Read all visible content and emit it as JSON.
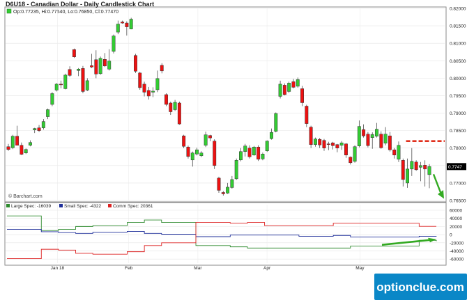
{
  "header": {
    "title": "D6U18 - Canadian Dollar - Daily Candlestick Chart",
    "ohlc": "Op:0.77235, Hi:0.77540, Lo:0.76850, Cl:0.77470",
    "watermark": "© Barchart.com",
    "brand": "optionclue.com"
  },
  "colors": {
    "bull": "#33cc33",
    "bear": "#ee1111",
    "large_spec": "#2e8b2e",
    "small_spec": "#1f2f9a",
    "comm_spec": "#dd2222",
    "target_line": "#e0301e",
    "arrow": "#33aa22",
    "brand_bg": "#0a87c7"
  },
  "chart_data": [
    {
      "type": "candlestick",
      "title": "D6U18 - Canadian Dollar - Daily Candlestick Chart",
      "ylim": [
        0.765,
        0.82
      ],
      "yticks": [
        "0.82000",
        "0.81500",
        "0.81000",
        "0.80500",
        "0.80000",
        "0.79500",
        "0.79000",
        "0.78500",
        "0.78000",
        "0.77500",
        "0.77000",
        "0.76500"
      ],
      "last_price_label": "0.7747",
      "months": [
        "Jan 18",
        "Feb",
        "Mar",
        "Apr",
        "May"
      ],
      "annotation": {
        "type": "dashed-level",
        "value": 0.782
      },
      "candles": [
        {
          "o": 0.7804,
          "h": 0.7812,
          "l": 0.7792,
          "c": 0.7796
        },
        {
          "o": 0.7801,
          "h": 0.7838,
          "l": 0.7797,
          "c": 0.7834
        },
        {
          "o": 0.7834,
          "h": 0.7864,
          "l": 0.7808,
          "c": 0.7808
        },
        {
          "o": 0.7808,
          "h": 0.7816,
          "l": 0.778,
          "c": 0.7782
        },
        {
          "o": 0.7786,
          "h": 0.7799,
          "l": 0.7783,
          "c": 0.7796
        },
        {
          "o": 0.7808,
          "h": 0.7822,
          "l": 0.7805,
          "c": 0.7816
        },
        {
          "o": 0.7852,
          "h": 0.7858,
          "l": 0.7843,
          "c": 0.7856
        },
        {
          "o": 0.7858,
          "h": 0.7866,
          "l": 0.7846,
          "c": 0.785
        },
        {
          "o": 0.7858,
          "h": 0.7883,
          "l": 0.7853,
          "c": 0.7876
        },
        {
          "o": 0.789,
          "h": 0.7913,
          "l": 0.7883,
          "c": 0.791
        },
        {
          "o": 0.7925,
          "h": 0.796,
          "l": 0.792,
          "c": 0.7956
        },
        {
          "o": 0.7966,
          "h": 0.7986,
          "l": 0.7962,
          "c": 0.7983
        },
        {
          "o": 0.7983,
          "h": 0.7993,
          "l": 0.7971,
          "c": 0.7982
        },
        {
          "o": 0.797,
          "h": 0.8013,
          "l": 0.7968,
          "c": 0.8009
        },
        {
          "o": 0.8025,
          "h": 0.8034,
          "l": 0.8004,
          "c": 0.8008
        },
        {
          "o": 0.8082,
          "h": 0.8085,
          "l": 0.8058,
          "c": 0.8061
        },
        {
          "o": 0.8022,
          "h": 0.8029,
          "l": 0.8006,
          "c": 0.8026
        },
        {
          "o": 0.8028,
          "h": 0.8035,
          "l": 0.7957,
          "c": 0.7962
        },
        {
          "o": 0.7966,
          "h": 0.8,
          "l": 0.7963,
          "c": 0.7993
        },
        {
          "o": 0.8036,
          "h": 0.807,
          "l": 0.8029,
          "c": 0.8032
        },
        {
          "o": 0.8053,
          "h": 0.808,
          "l": 0.8,
          "c": 0.8012
        },
        {
          "o": 0.8013,
          "h": 0.8062,
          "l": 0.801,
          "c": 0.8057
        },
        {
          "o": 0.8054,
          "h": 0.8072,
          "l": 0.8032,
          "c": 0.8035
        },
        {
          "o": 0.8026,
          "h": 0.8083,
          "l": 0.8022,
          "c": 0.8049
        },
        {
          "o": 0.8077,
          "h": 0.8125,
          "l": 0.8071,
          "c": 0.8121
        },
        {
          "o": 0.8132,
          "h": 0.8165,
          "l": 0.8126,
          "c": 0.8155
        },
        {
          "o": 0.8161,
          "h": 0.8165,
          "l": 0.8156,
          "c": 0.8158
        },
        {
          "o": 0.8158,
          "h": 0.8163,
          "l": 0.8122,
          "c": 0.8147
        },
        {
          "o": 0.8141,
          "h": 0.8173,
          "l": 0.814,
          "c": 0.8169
        },
        {
          "o": 0.8065,
          "h": 0.807,
          "l": 0.8015,
          "c": 0.802
        },
        {
          "o": 0.8015,
          "h": 0.8018,
          "l": 0.7967,
          "c": 0.7973
        },
        {
          "o": 0.7983,
          "h": 0.799,
          "l": 0.7948,
          "c": 0.796
        },
        {
          "o": 0.7965,
          "h": 0.7975,
          "l": 0.7939,
          "c": 0.7949
        },
        {
          "o": 0.796,
          "h": 0.7974,
          "l": 0.7946,
          "c": 0.7963
        },
        {
          "o": 0.7967,
          "h": 0.8022,
          "l": 0.796,
          "c": 0.7999
        },
        {
          "o": 0.8037,
          "h": 0.8043,
          "l": 0.8014,
          "c": 0.8021
        },
        {
          "o": 0.7953,
          "h": 0.7957,
          "l": 0.792,
          "c": 0.7925
        },
        {
          "o": 0.7929,
          "h": 0.7933,
          "l": 0.7895,
          "c": 0.7904
        },
        {
          "o": 0.791,
          "h": 0.7938,
          "l": 0.7906,
          "c": 0.7931
        },
        {
          "o": 0.7929,
          "h": 0.7933,
          "l": 0.7867,
          "c": 0.7869
        },
        {
          "o": 0.7835,
          "h": 0.7838,
          "l": 0.78,
          "c": 0.7805
        },
        {
          "o": 0.7803,
          "h": 0.7807,
          "l": 0.777,
          "c": 0.7776
        },
        {
          "o": 0.7766,
          "h": 0.779,
          "l": 0.7747,
          "c": 0.7786
        },
        {
          "o": 0.7783,
          "h": 0.7801,
          "l": 0.7779,
          "c": 0.7795
        },
        {
          "o": 0.7778,
          "h": 0.7791,
          "l": 0.7774,
          "c": 0.7786
        },
        {
          "o": 0.7808,
          "h": 0.7847,
          "l": 0.7803,
          "c": 0.7838
        },
        {
          "o": 0.7836,
          "h": 0.7838,
          "l": 0.782,
          "c": 0.7829
        },
        {
          "o": 0.782,
          "h": 0.7825,
          "l": 0.774,
          "c": 0.775
        },
        {
          "o": 0.7714,
          "h": 0.7718,
          "l": 0.7672,
          "c": 0.7679
        },
        {
          "o": 0.7673,
          "h": 0.7677,
          "l": 0.7664,
          "c": 0.7669
        },
        {
          "o": 0.7671,
          "h": 0.77,
          "l": 0.7669,
          "c": 0.7688
        },
        {
          "o": 0.7687,
          "h": 0.772,
          "l": 0.7684,
          "c": 0.771
        },
        {
          "o": 0.7712,
          "h": 0.777,
          "l": 0.7709,
          "c": 0.7765
        },
        {
          "o": 0.7766,
          "h": 0.78,
          "l": 0.7762,
          "c": 0.779
        },
        {
          "o": 0.779,
          "h": 0.7812,
          "l": 0.7776,
          "c": 0.7806
        },
        {
          "o": 0.78,
          "h": 0.7808,
          "l": 0.777,
          "c": 0.7775
        },
        {
          "o": 0.778,
          "h": 0.7806,
          "l": 0.7778,
          "c": 0.7803
        },
        {
          "o": 0.7803,
          "h": 0.7808,
          "l": 0.7763,
          "c": 0.7768
        },
        {
          "o": 0.7769,
          "h": 0.7787,
          "l": 0.7765,
          "c": 0.7783
        },
        {
          "o": 0.7792,
          "h": 0.7822,
          "l": 0.7789,
          "c": 0.782
        },
        {
          "o": 0.7827,
          "h": 0.7856,
          "l": 0.7824,
          "c": 0.7845
        },
        {
          "o": 0.7848,
          "h": 0.7902,
          "l": 0.7845,
          "c": 0.7899
        },
        {
          "o": 0.7948,
          "h": 0.7993,
          "l": 0.7942,
          "c": 0.7983
        },
        {
          "o": 0.798,
          "h": 0.7985,
          "l": 0.7951,
          "c": 0.7953
        },
        {
          "o": 0.7962,
          "h": 0.799,
          "l": 0.7958,
          "c": 0.7986
        },
        {
          "o": 0.799,
          "h": 0.7998,
          "l": 0.7971,
          "c": 0.7974
        },
        {
          "o": 0.7977,
          "h": 0.8002,
          "l": 0.7973,
          "c": 0.7996
        },
        {
          "o": 0.797,
          "h": 0.7978,
          "l": 0.792,
          "c": 0.793
        },
        {
          "o": 0.792,
          "h": 0.7924,
          "l": 0.786,
          "c": 0.787
        },
        {
          "o": 0.786,
          "h": 0.7864,
          "l": 0.78,
          "c": 0.781
        },
        {
          "o": 0.781,
          "h": 0.783,
          "l": 0.7804,
          "c": 0.7826
        },
        {
          "o": 0.7825,
          "h": 0.7829,
          "l": 0.78,
          "c": 0.7809
        },
        {
          "o": 0.7822,
          "h": 0.7826,
          "l": 0.7792,
          "c": 0.78
        },
        {
          "o": 0.7812,
          "h": 0.7818,
          "l": 0.7794,
          "c": 0.7811
        },
        {
          "o": 0.7815,
          "h": 0.7818,
          "l": 0.7796,
          "c": 0.7807
        },
        {
          "o": 0.781,
          "h": 0.7812,
          "l": 0.7788,
          "c": 0.78
        },
        {
          "o": 0.7808,
          "h": 0.782,
          "l": 0.7795,
          "c": 0.7815
        },
        {
          "o": 0.7812,
          "h": 0.7814,
          "l": 0.7772,
          "c": 0.778
        },
        {
          "o": 0.7774,
          "h": 0.7776,
          "l": 0.7753,
          "c": 0.7758
        },
        {
          "o": 0.7762,
          "h": 0.7808,
          "l": 0.7758,
          "c": 0.7804
        },
        {
          "o": 0.7806,
          "h": 0.7879,
          "l": 0.7802,
          "c": 0.7862
        },
        {
          "o": 0.7853,
          "h": 0.7868,
          "l": 0.783,
          "c": 0.7835
        },
        {
          "o": 0.784,
          "h": 0.7846,
          "l": 0.7802,
          "c": 0.7807
        },
        {
          "o": 0.783,
          "h": 0.7845,
          "l": 0.7798,
          "c": 0.7839
        },
        {
          "o": 0.7834,
          "h": 0.7872,
          "l": 0.783,
          "c": 0.7854
        },
        {
          "o": 0.784,
          "h": 0.7848,
          "l": 0.7798,
          "c": 0.7801
        },
        {
          "o": 0.7814,
          "h": 0.786,
          "l": 0.7808,
          "c": 0.784
        },
        {
          "o": 0.7835,
          "h": 0.7846,
          "l": 0.779,
          "c": 0.7795
        },
        {
          "o": 0.7795,
          "h": 0.78,
          "l": 0.777,
          "c": 0.778
        },
        {
          "o": 0.7768,
          "h": 0.7819,
          "l": 0.776,
          "c": 0.7808
        },
        {
          "o": 0.7765,
          "h": 0.777,
          "l": 0.769,
          "c": 0.771
        },
        {
          "o": 0.77,
          "h": 0.777,
          "l": 0.7686,
          "c": 0.774
        },
        {
          "o": 0.774,
          "h": 0.78,
          "l": 0.772,
          "c": 0.7762
        },
        {
          "o": 0.776,
          "h": 0.7765,
          "l": 0.7735,
          "c": 0.7738
        },
        {
          "o": 0.7745,
          "h": 0.776,
          "l": 0.7705,
          "c": 0.775
        },
        {
          "o": 0.7751,
          "h": 0.7765,
          "l": 0.769,
          "c": 0.774
        },
        {
          "o": 0.7724,
          "h": 0.7754,
          "l": 0.7685,
          "c": 0.7747
        }
      ]
    },
    {
      "type": "line",
      "subtype": "step",
      "ylim": [
        -70000,
        60000
      ],
      "yticks": [
        "60000",
        "40000",
        "20000",
        "0",
        "-20000",
        "-40000",
        "-60000"
      ],
      "months": [
        "Jan 18",
        "Feb",
        "Mar",
        "Apr",
        "May"
      ],
      "x": [
        0,
        1,
        2,
        3,
        4,
        5,
        6,
        7,
        8,
        9,
        10,
        11,
        12,
        13,
        14,
        15,
        16,
        17,
        18,
        19,
        20,
        21,
        22,
        23,
        24,
        25
      ],
      "series": [
        {
          "name": "Large Spec: -16039",
          "values": [
            46000,
            46000,
            10000,
            13000,
            20000,
            22000,
            22000,
            30000,
            36000,
            30000,
            30000,
            -27000,
            -27000,
            -30000,
            -33000,
            -33000,
            -33000,
            -33000,
            -33000,
            -33000,
            -28000,
            -28000,
            -28000,
            -28000,
            -14000,
            -16039
          ]
        },
        {
          "name": "Small Spec: -4322",
          "values": [
            13000,
            13000,
            7000,
            5000,
            3000,
            6000,
            6000,
            8000,
            3000,
            1000,
            1000,
            -5000,
            -5000,
            -1000,
            -1000,
            -1000,
            -1000,
            -4000,
            -4000,
            -2000,
            -6000,
            -6000,
            -6000,
            -6000,
            -4000,
            -4322
          ]
        },
        {
          "name": "Comm Spec: 20361",
          "values": [
            -59000,
            -59000,
            -36000,
            -38000,
            -46000,
            -48000,
            -48000,
            -42000,
            -27000,
            -20000,
            -20000,
            30000,
            30000,
            28000,
            30000,
            22000,
            22000,
            22000,
            22000,
            28000,
            28000,
            28000,
            28000,
            28000,
            20361,
            20361
          ]
        }
      ]
    }
  ]
}
